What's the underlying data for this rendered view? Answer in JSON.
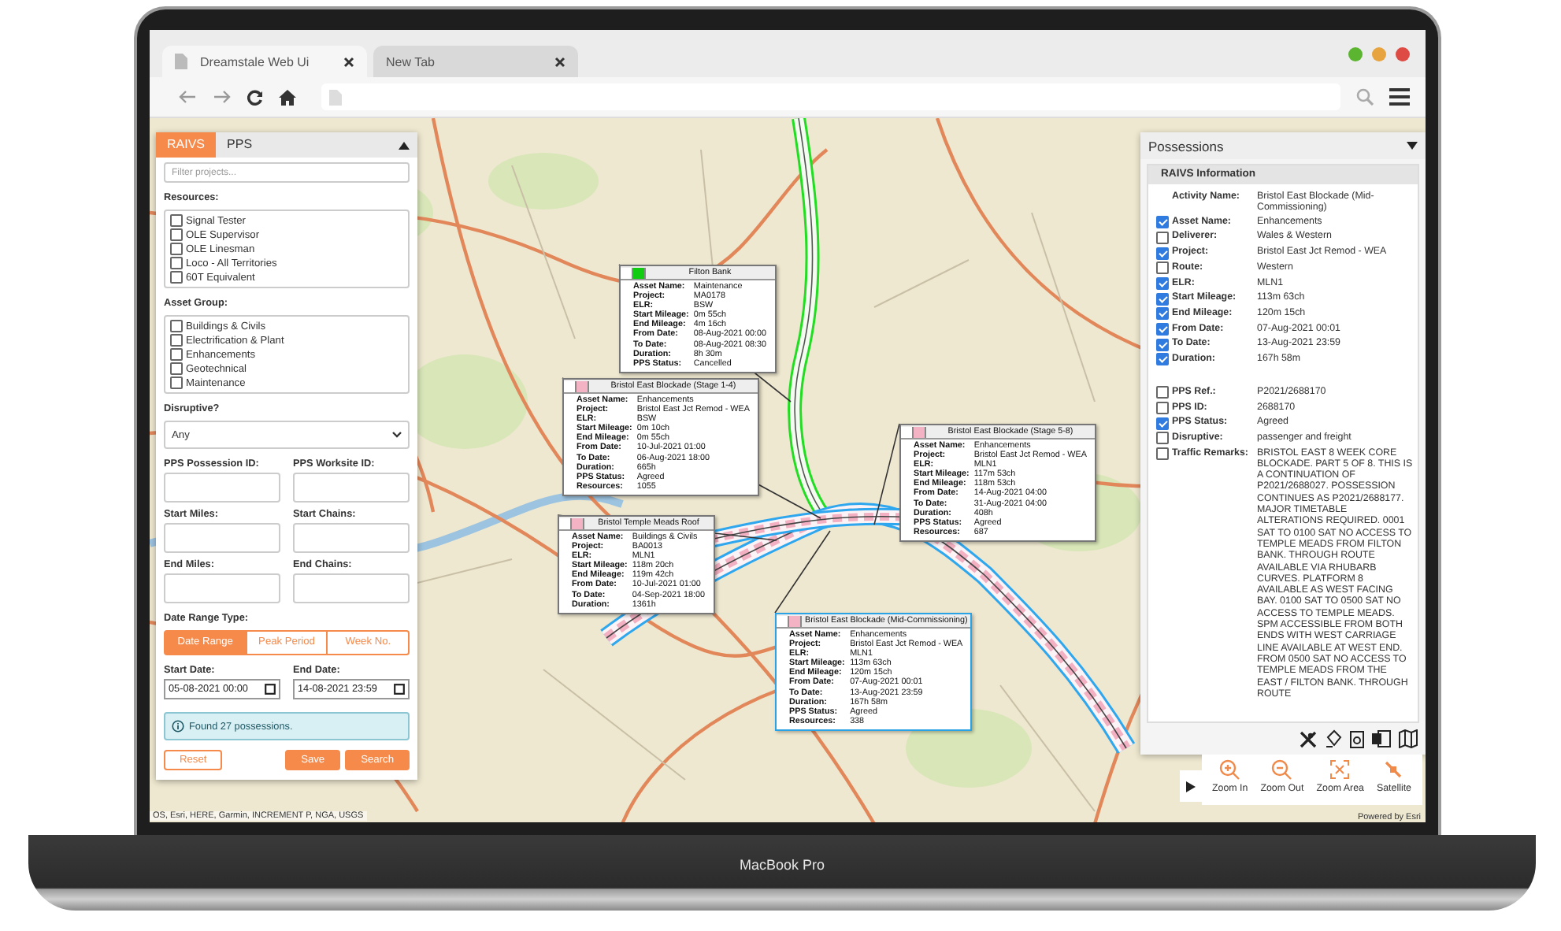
{
  "browser": {
    "tabs": [
      {
        "label": "Dreamstale Web Ui",
        "selected": true
      },
      {
        "label": "New Tab",
        "selected": false
      }
    ]
  },
  "filter_panel": {
    "tabs": [
      {
        "label": "RAIVS",
        "selected": true
      },
      {
        "label": "PPS",
        "selected": false
      }
    ],
    "filter_placeholder": "Filter projects...",
    "resources": {
      "label": "Resources:",
      "items": [
        {
          "label": "Signal Tester",
          "checked": false
        },
        {
          "label": "OLE Supervisor",
          "checked": false
        },
        {
          "label": "OLE Linesman",
          "checked": false
        },
        {
          "label": "Loco - All Territories",
          "checked": false
        },
        {
          "label": "60T Equivalent",
          "checked": false
        }
      ]
    },
    "asset_group": {
      "label": "Asset Group:",
      "items": [
        {
          "label": "Buildings & Civils",
          "checked": false
        },
        {
          "label": "Electrification & Plant",
          "checked": false
        },
        {
          "label": "Enhancements",
          "checked": false
        },
        {
          "label": "Geotechnical",
          "checked": false
        },
        {
          "label": "Maintenance",
          "checked": false
        }
      ]
    },
    "disruptive": {
      "label": "Disruptive?",
      "value": "Any"
    },
    "fields": [
      {
        "label": "PPS Possession ID:"
      },
      {
        "label": "PPS Worksite ID:"
      },
      {
        "label": "Start Miles:"
      },
      {
        "label": "Start Chains:"
      },
      {
        "label": "End Miles:"
      },
      {
        "label": "End Chains:"
      }
    ],
    "date_range_type": {
      "label": "Date Range Type:",
      "options": [
        {
          "label": "Date Range",
          "selected": true
        },
        {
          "label": "Peak Period",
          "selected": false
        },
        {
          "label": "Week No.",
          "selected": false
        }
      ]
    },
    "start_date": {
      "label": "Start Date:",
      "value": "05-08-2021 00:00"
    },
    "end_date": {
      "label": "End Date:",
      "value": "14-08-2021 23:59"
    },
    "message": "Found 27 possessions.",
    "buttons": [
      {
        "label": "Reset",
        "kind": "secondary"
      },
      {
        "label": "Save",
        "kind": "primary"
      },
      {
        "label": "Search",
        "kind": "primary"
      }
    ]
  },
  "map": {
    "popups": [
      {
        "title": "Filton Bank",
        "color": "#11cc11",
        "selected": false,
        "rows": [
          {
            "label": "Asset Name:",
            "value": "Maintenance"
          },
          {
            "label": "Project:",
            "value": "MA0178"
          },
          {
            "label": "ELR:",
            "value": "BSW"
          },
          {
            "label": "Start Mileage:",
            "value": "0m 55ch"
          },
          {
            "label": "End Mileage:",
            "value": "4m 16ch"
          },
          {
            "label": "From Date:",
            "value": "08-Aug-2021 00:00"
          },
          {
            "label": "To Date:",
            "value": "08-Aug-2021 08:30"
          },
          {
            "label": "Duration:",
            "value": "8h 30m"
          },
          {
            "label": "PPS Status:",
            "value": "Cancelled"
          }
        ]
      },
      {
        "title": "Bristol East Blockade (Stage 1-4)",
        "color": "#f4b3c5",
        "selected": false,
        "rows": [
          {
            "label": "Asset Name:",
            "value": "Enhancements"
          },
          {
            "label": "Project:",
            "value": "Bristol East Jct Remod - WEA"
          },
          {
            "label": "ELR:",
            "value": "BSW"
          },
          {
            "label": "Start Mileage:",
            "value": "0m 10ch"
          },
          {
            "label": "End Mileage:",
            "value": "0m 55ch"
          },
          {
            "label": "From Date:",
            "value": "10-Jul-2021 01:00"
          },
          {
            "label": "To Date:",
            "value": "06-Aug-2021 18:00"
          },
          {
            "label": "Duration:",
            "value": "665h"
          },
          {
            "label": "PPS Status:",
            "value": "Agreed"
          },
          {
            "label": "Resources:",
            "value": "1055"
          }
        ]
      },
      {
        "title": "Bristol East Blockade (Stage 5-8)",
        "color": "#f4b3c5",
        "selected": false,
        "rows": [
          {
            "label": "Asset Name:",
            "value": "Enhancements"
          },
          {
            "label": "Project:",
            "value": "Bristol East Jct Remod - WEA"
          },
          {
            "label": "ELR:",
            "value": "MLN1"
          },
          {
            "label": "Start Mileage:",
            "value": "117m 53ch"
          },
          {
            "label": "End Mileage:",
            "value": "118m 53ch"
          },
          {
            "label": "From Date:",
            "value": "14-Aug-2021 04:00"
          },
          {
            "label": "To Date:",
            "value": "31-Aug-2021 04:00"
          },
          {
            "label": "Duration:",
            "value": "408h"
          },
          {
            "label": "PPS Status:",
            "value": "Agreed"
          },
          {
            "label": "Resources:",
            "value": "687"
          }
        ]
      },
      {
        "title": "Bristol Temple Meads Roof",
        "color": "#f4b3c5",
        "selected": false,
        "rows": [
          {
            "label": "Asset Name:",
            "value": "Buildings & Civils"
          },
          {
            "label": "Project:",
            "value": "BA0013"
          },
          {
            "label": "ELR:",
            "value": "MLN1"
          },
          {
            "label": "Start Mileage:",
            "value": "118m 20ch"
          },
          {
            "label": "End Mileage:",
            "value": "119m 42ch"
          },
          {
            "label": "From Date:",
            "value": "10-Jul-2021 01:00"
          },
          {
            "label": "To Date:",
            "value": "04-Sep-2021 18:00"
          },
          {
            "label": "Duration:",
            "value": "1361h"
          }
        ]
      },
      {
        "title": "Bristol East Blockade (Mid-Commissioning)",
        "color": "#f4b3c5",
        "selected": true,
        "rows": [
          {
            "label": "Asset Name:",
            "value": "Enhancements"
          },
          {
            "label": "Project:",
            "value": "Bristol East Jct Remod - WEA"
          },
          {
            "label": "ELR:",
            "value": "MLN1"
          },
          {
            "label": "Start Mileage:",
            "value": "113m 63ch"
          },
          {
            "label": "End Mileage:",
            "value": "120m 15ch"
          },
          {
            "label": "From Date:",
            "value": "07-Aug-2021 00:01"
          },
          {
            "label": "To Date:",
            "value": "13-Aug-2021 23:59"
          },
          {
            "label": "Duration:",
            "value": "167h 58m"
          },
          {
            "label": "PPS Status:",
            "value": "Agreed"
          },
          {
            "label": "Resources:",
            "value": "338"
          }
        ]
      }
    ],
    "attribution": "OS, Esri, HERE, Garmin, INCREMENT P, NGA, USGS",
    "powered_by": "Powered by Esri",
    "toolbar": [
      {
        "label": "Zoom In",
        "kind": "zoom_in"
      },
      {
        "label": "Zoom Out",
        "kind": "zoom_out"
      },
      {
        "label": "Zoom Area",
        "kind": "zoom_area"
      },
      {
        "label": "Satellite",
        "kind": "satellite"
      }
    ]
  },
  "possessions_panel": {
    "title": "Possessions",
    "section_title": "RAIVS Information",
    "activity": {
      "label": "Activity Name:",
      "value": "Bristol East Blockade (Mid-Commissioning)"
    },
    "fields": [
      {
        "label": "Asset Name:",
        "value": "Enhancements",
        "checked": true
      },
      {
        "label": "Deliverer:",
        "value": "Wales & Western",
        "checked": false
      },
      {
        "label": "Project:",
        "value": "Bristol East Jct Remod - WEA",
        "checked": true
      },
      {
        "label": "Route:",
        "value": "Western",
        "checked": false
      },
      {
        "label": "ELR:",
        "value": "MLN1",
        "checked": true
      },
      {
        "label": "Start Mileage:",
        "value": "113m 63ch",
        "checked": true
      },
      {
        "label": "End Mileage:",
        "value": "120m 15ch",
        "checked": true
      },
      {
        "label": "From Date:",
        "value": "07-Aug-2021 00:01",
        "checked": true
      },
      {
        "label": "To Date:",
        "value": "13-Aug-2021 23:59",
        "checked": true
      },
      {
        "label": "Duration:",
        "value": "167h 58m",
        "checked": true
      }
    ],
    "pps_fields": [
      {
        "label": "PPS Ref.:",
        "value": "P2021/2688170",
        "checked": false
      },
      {
        "label": "PPS ID:",
        "value": "2688170",
        "checked": false
      },
      {
        "label": "PPS Status:",
        "value": "Agreed",
        "checked": true
      },
      {
        "label": "Disruptive:",
        "value": "passenger and freight",
        "checked": false
      },
      {
        "label": "Traffic Remarks:",
        "value": "BRISTOL EAST 8 WEEK CORE BLOCKADE. PART 5 OF 8. THIS IS A CONTINUATION OF P2021/2688027. POSSESSION CONTINUES AS P2021/2688177. MAJOR TIMETABLE ALTERATIONS REQUIRED. 0001 SAT TO 0100 SAT NO ACCESS TO TEMPLE MEADS FROM FILTON BANK. THROUGH ROUTE AVAILABLE VIA RHUBARB CURVES. PLATFORM 8 AVAILABLE AS WEST FACING BAY. 0100 SAT TO 0500 SAT NO ACCESS TO TEMPLE MEADS. SPM ACCESSIBLE FROM BOTH ENDS WITH WEST CARRIAGE LINE AVAILABLE AT WEST END. FROM 0500 SAT NO ACCESS TO TEMPLE MEADS FROM THE EAST / FILTON BANK. THROUGH ROUTE",
        "checked": false
      }
    ]
  },
  "device_label": "MacBook Pro"
}
